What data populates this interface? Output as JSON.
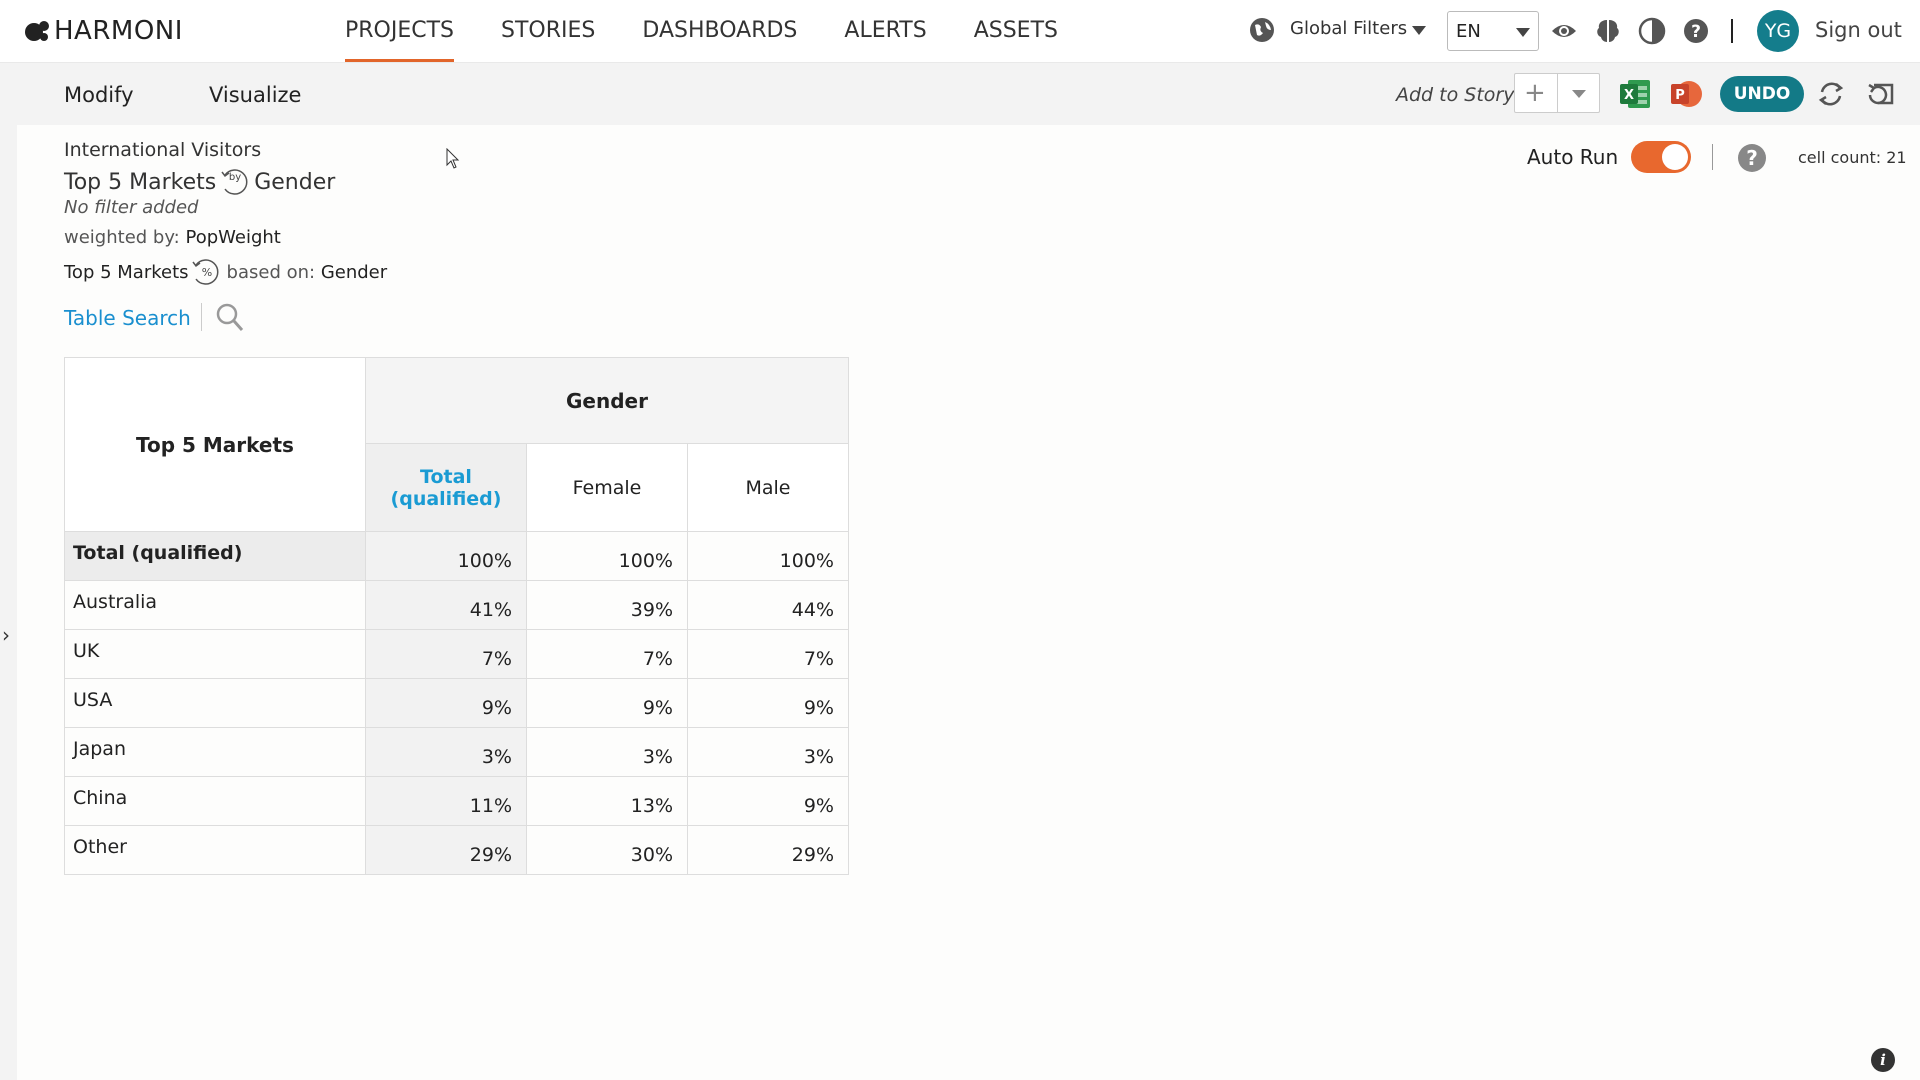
{
  "app": {
    "name": "HARMONI"
  },
  "nav": {
    "items": [
      {
        "label": "PROJECTS",
        "active": true
      },
      {
        "label": "STORIES"
      },
      {
        "label": "DASHBOARDS"
      },
      {
        "label": "ALERTS"
      },
      {
        "label": "ASSETS"
      }
    ],
    "global_filters": "Global Filters",
    "language": "EN",
    "avatar_initials": "YG",
    "sign_out": "Sign out"
  },
  "toolbar": {
    "tabs": [
      "Modify",
      "Visualize"
    ],
    "add_to_story": "Add to Story",
    "undo": "UNDO"
  },
  "header": {
    "project": "International Visitors",
    "row_var": "Top 5 Markets",
    "by_icon_text": "by",
    "col_var": "Gender",
    "filter": "No filter added",
    "weighted_prefix": "weighted by:",
    "weight": "PopWeight",
    "base_row_var": "Top 5 Markets",
    "pct_icon_text": "%",
    "based_on_prefix": "based on:",
    "based_on": "Gender",
    "table_search": "Table Search"
  },
  "controls": {
    "auto_run_label": "Auto Run",
    "auto_run_on": true,
    "cell_count": "cell count: 21"
  },
  "table": {
    "corner_label": "Top 5 Markets",
    "group_label": "Gender",
    "columns": [
      "Total (qualified)",
      "Female",
      "Male"
    ],
    "rows": [
      {
        "label": "Total (qualified)",
        "values": [
          "100%",
          "100%",
          "100%"
        ]
      },
      {
        "label": "Australia",
        "values": [
          "41%",
          "39%",
          "44%"
        ]
      },
      {
        "label": "UK",
        "values": [
          "7%",
          "7%",
          "7%"
        ]
      },
      {
        "label": "USA",
        "values": [
          "9%",
          "9%",
          "9%"
        ]
      },
      {
        "label": "Japan",
        "values": [
          "3%",
          "3%",
          "3%"
        ]
      },
      {
        "label": "China",
        "values": [
          "11%",
          "13%",
          "9%"
        ]
      },
      {
        "label": "Other",
        "values": [
          "29%",
          "30%",
          "29%"
        ]
      }
    ]
  },
  "colors": {
    "accent": "#e2652a",
    "teal": "#137a87",
    "link": "#1a8fcf"
  },
  "icons": [
    "globe-icon",
    "eye-icon",
    "brain-icon",
    "contrast-icon",
    "help-icon",
    "excel-icon",
    "powerpoint-icon",
    "refresh-icon",
    "restore-icon",
    "search-icon",
    "info-icon"
  ]
}
